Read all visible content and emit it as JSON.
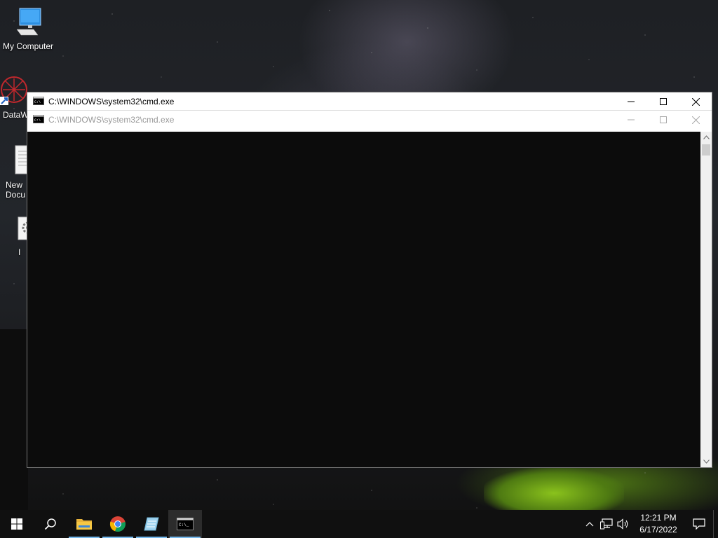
{
  "desktop": {
    "icons": [
      {
        "label": "My Computer",
        "icon": "computer-icon"
      },
      {
        "label": "DataW",
        "icon": "datawrapper-icon"
      },
      {
        "label": "New\nDocu",
        "icon": "text-document-icon"
      },
      {
        "label": "I",
        "icon": "settings-file-icon"
      }
    ]
  },
  "windows": [
    {
      "title": "C:\\WINDOWS\\system32\\cmd.exe",
      "icon": "cmd-icon",
      "state": "active"
    },
    {
      "title": "C:\\WINDOWS\\system32\\cmd.exe",
      "icon": "cmd-icon",
      "state": "inactive"
    }
  ],
  "window_controls": {
    "minimize": "minimize-icon",
    "maximize": "maximize-icon",
    "close": "close-icon"
  },
  "taskbar": {
    "buttons": [
      {
        "name": "start",
        "icon": "windows-logo-icon"
      },
      {
        "name": "search",
        "icon": "search-icon"
      },
      {
        "name": "file-explorer",
        "icon": "folder-icon"
      },
      {
        "name": "chrome",
        "icon": "chrome-icon"
      },
      {
        "name": "notepad",
        "icon": "notepad-icon"
      },
      {
        "name": "cmd",
        "icon": "cmd-icon"
      }
    ],
    "tray": {
      "time": "12:21 PM",
      "date": "6/17/2022"
    }
  },
  "colors": {
    "console_bg": "#0c0c0c",
    "taskbar_bg": "#101010",
    "accent_underline": "#76b9ed"
  }
}
